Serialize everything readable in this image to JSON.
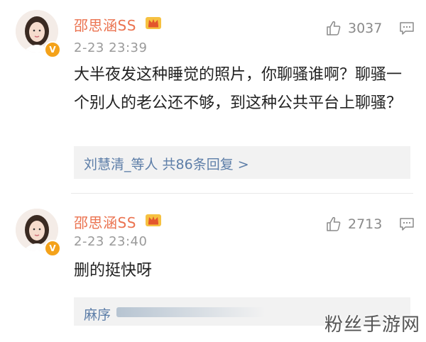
{
  "comments": [
    {
      "user": "邵思涵SS",
      "time": "2-23 23:39",
      "likes": "3037",
      "text": "大半夜发这种睡觉的照片，你聊骚谁啊？聊骚一个别人的老公还不够，到这种公共平台上聊骚？",
      "replies": "刘慧清_等人  共86条回复 >"
    },
    {
      "user": "邵思涵SS",
      "time": "2-23 23:40",
      "likes": "2713",
      "text": "删的挺快呀",
      "replies": "麻序"
    }
  ],
  "watermark": "粉丝手游网",
  "colors": {
    "username": "#eb7350",
    "link": "#5d7ea8",
    "badge": "#f4a21a"
  },
  "icons": [
    "avatar",
    "verified-badge-icon",
    "crown-badge-icon",
    "thumbs-up-icon",
    "reply-comment-icon"
  ]
}
